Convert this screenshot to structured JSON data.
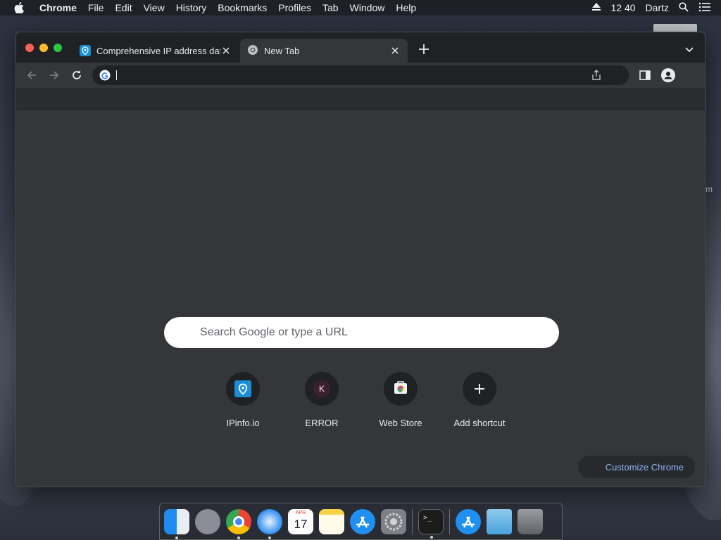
{
  "menubar": {
    "app_name": "Chrome",
    "menus": [
      "File",
      "Edit",
      "View",
      "History",
      "Bookmarks",
      "Profiles",
      "Tab",
      "Window",
      "Help"
    ],
    "clock": "12 40",
    "user": "Dartz"
  },
  "tabs": [
    {
      "title": "Comprehensive IP address data",
      "favicon": "ipinfo-icon",
      "active": false
    },
    {
      "title": "New Tab",
      "favicon": "chrome-icon",
      "active": true
    }
  ],
  "omnibox": {
    "value": ""
  },
  "ntp": {
    "search_placeholder": "Search Google or type a URL",
    "shortcuts": [
      {
        "label": "IPinfo.io",
        "icon": "ipinfo-icon"
      },
      {
        "label": "ERROR",
        "icon": "letter-k-icon",
        "letter": "K"
      },
      {
        "label": "Web Store",
        "icon": "web-store-icon"
      },
      {
        "label": "Add shortcut",
        "icon": "plus-icon"
      }
    ],
    "customize_label": "Customize Chrome"
  },
  "dock": {
    "apps": [
      "Finder",
      "Launchpad",
      "Google Chrome",
      "Safari",
      "Calendar",
      "Notes",
      "App Store",
      "System Preferences",
      "Terminal",
      "Applications",
      "Downloads",
      "Trash"
    ],
    "calendar_month": "APR",
    "calendar_day": "17"
  },
  "colors": {
    "accent_link": "#8ab4f8",
    "tabstrip": "#202124",
    "toolbar": "#35363a"
  }
}
